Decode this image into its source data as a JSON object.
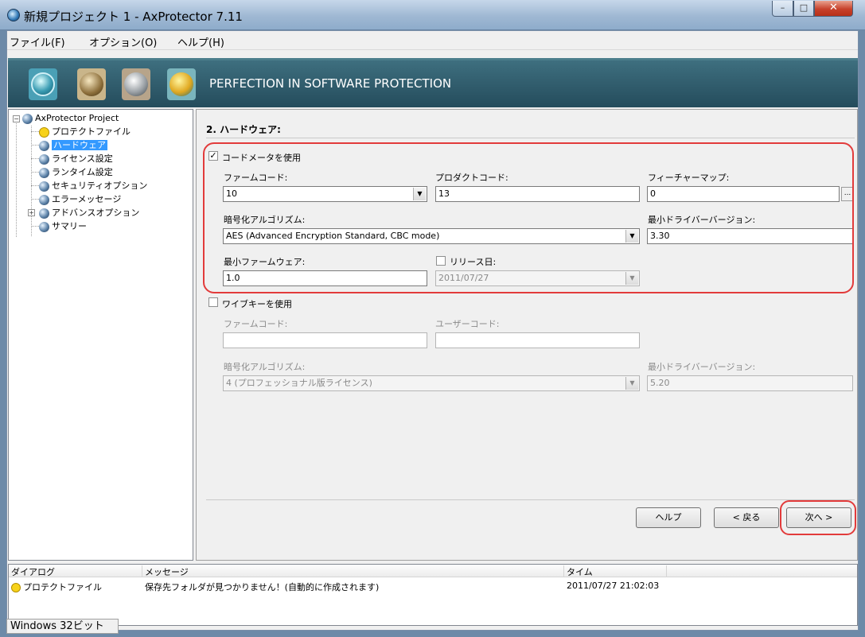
{
  "window": {
    "title": "新規プロジェクト 1 - AxProtector 7.11"
  },
  "menu": [
    "ファイル(F)",
    "オプション(O)",
    "ヘルプ(H)"
  ],
  "banner": {
    "tagline": "PERFECTION IN SOFTWARE PROTECTION"
  },
  "tree": {
    "root": "AxProtector Project",
    "items": [
      "プロテクトファイル",
      "ハードウェア",
      "ライセンス設定",
      "ランタイム設定",
      "セキュリティオプション",
      "エラーメッセージ",
      "アドバンスオプション",
      "サマリー"
    ]
  },
  "section": {
    "title": "2. ハードウェア:"
  },
  "codemeter": {
    "use_label": "コードメータを使用",
    "use_mark": "✓",
    "firm_code_label": "ファームコード:",
    "firm_code_value": "10",
    "product_code_label": "プロダクトコード:",
    "product_code_value": "13",
    "feature_map_label": "フィーチャーマップ:",
    "feature_map_value": "0",
    "encryption_label": "暗号化アルゴリズム:",
    "encryption_value": "AES (Advanced Encryption Standard, CBC mode)",
    "min_driver_label": "最小ドライバーバージョン:",
    "min_driver_value": "3.30",
    "min_firmware_label": "最小ファームウェア:",
    "min_firmware_value": "1.0",
    "release_date_label": "リリース日:",
    "release_date_value": "2011/07/27"
  },
  "wibukey": {
    "use_label": "ワイブキーを使用",
    "firm_code_label": "ファームコード:",
    "user_code_label": "ユーザーコード:",
    "encryption_label": "暗号化アルゴリズム:",
    "encryption_value": "4 (プロフェッショナル版ライセンス)",
    "min_driver_label": "最小ドライバーバージョン:",
    "min_driver_value": "5.20"
  },
  "buttons": {
    "help": "ヘルプ",
    "back": "< 戻る",
    "next": "次へ >"
  },
  "log": {
    "headers": [
      "ダイアログ",
      "メッセージ",
      "タイム"
    ],
    "rows": [
      {
        "dialog": "プロテクトファイル",
        "message": "保存先フォルダが見つかりません！(自動的に作成されます)",
        "time": "2011/07/27 21:02:03"
      }
    ]
  },
  "status": {
    "platform": "Windows 32ビット"
  },
  "colors": {
    "highlight": "#e23b3b",
    "banner": "#2f5a6a",
    "selection": "#3399ff"
  }
}
